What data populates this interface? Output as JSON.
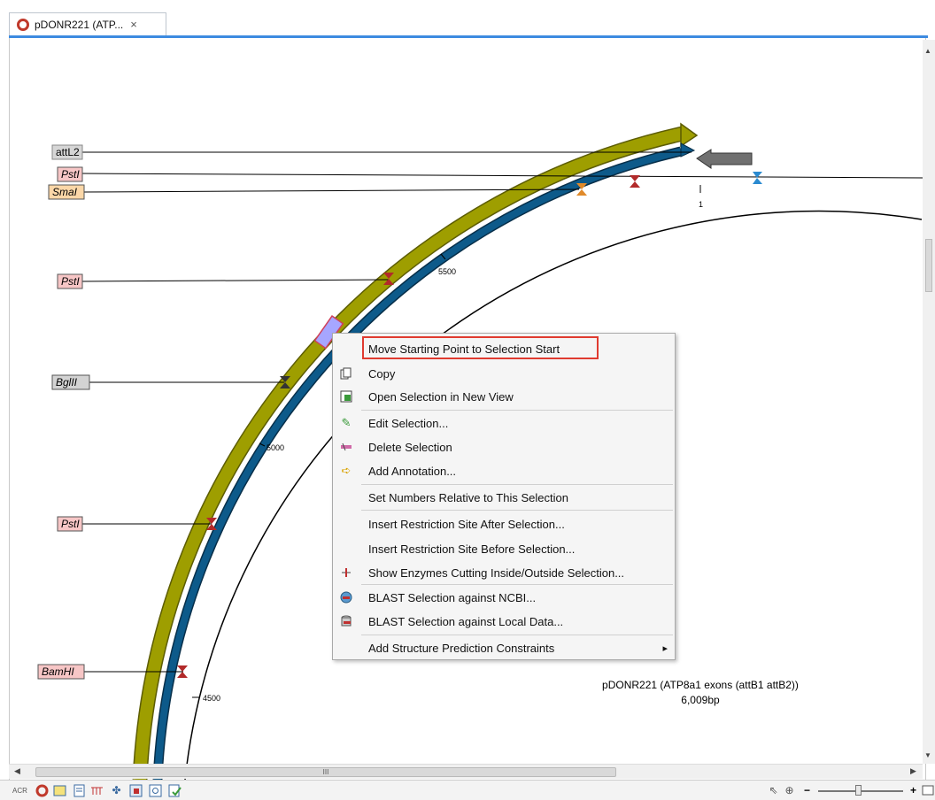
{
  "tab": {
    "title": "pDONR221 (ATP...",
    "close": "×",
    "icon": "circular-sequence-icon"
  },
  "map": {
    "title": "pDONR221 (ATP8a1 exons (attB1 attB2))",
    "length": "6,009bp",
    "feature_labels": [
      "attL2",
      "PstI",
      "SmaI",
      "PstI",
      "BglII",
      "PstI",
      "BamHI"
    ],
    "position_labels": [
      "5500",
      "5000",
      "4500",
      "1"
    ]
  },
  "colors": {
    "accent": "#3d8be0",
    "attL2_arrow": "#9e9e00",
    "blue_arrow": "#0d5a8a",
    "enzyme_label_pink": "#f7c6c6",
    "enzyme_label_orange": "#fbd7a8",
    "enzyme_label_gray": "#d3d3d3",
    "highlight": "#e03b30",
    "selection": "#9a9aff"
  },
  "context_menu": {
    "items": [
      {
        "label": "Move Starting Point to Selection Start",
        "icon": ""
      },
      {
        "label": "Copy",
        "icon": "copy-icon"
      },
      {
        "label": "Open Selection in New View",
        "icon": "new-view-icon"
      },
      {
        "label": "Edit Selection...",
        "icon": "pencil-icon"
      },
      {
        "label": "Delete Selection",
        "icon": "delete-selection-icon"
      },
      {
        "label": "Add Annotation...",
        "icon": "add-annotation-icon"
      },
      {
        "label": "Set Numbers Relative to This Selection",
        "icon": ""
      },
      {
        "label": "Insert Restriction Site After Selection...",
        "icon": ""
      },
      {
        "label": "Insert Restriction Site Before Selection...",
        "icon": ""
      },
      {
        "label": "Show Enzymes Cutting Inside/Outside Selection...",
        "icon": "enzymes-icon"
      },
      {
        "label": "BLAST Selection against NCBI...",
        "icon": "blast-ncbi-icon"
      },
      {
        "label": "BLAST Selection against Local Data...",
        "icon": "blast-local-icon"
      },
      {
        "label": "Add Structure Prediction Constraints",
        "icon": ""
      }
    ],
    "submenu_arrow": "▸"
  },
  "scrollbar": {
    "grip": "III"
  },
  "statusbar": {
    "left_icons": [
      "acr-icon",
      "circular-view-icon",
      "sequence-view-icon",
      "text-view-icon",
      "enzymes-view-icon",
      "graph-icon",
      "table-icon",
      "history-icon",
      "annotation-icon"
    ],
    "right_icons": [
      "pointer-icon",
      "zoom-icon"
    ],
    "zoom_minus": "−",
    "zoom_plus": "+"
  }
}
